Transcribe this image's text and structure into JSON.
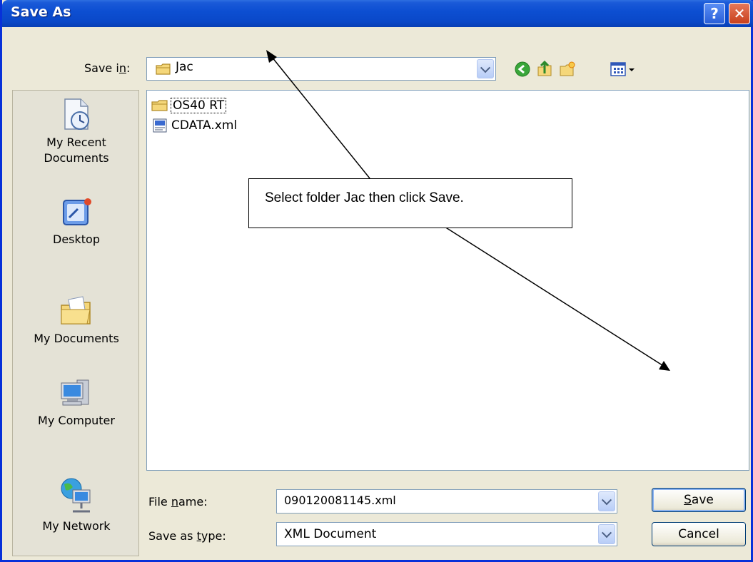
{
  "window": {
    "title": "Save As"
  },
  "title_buttons": {
    "help": "?",
    "close": "✕"
  },
  "save_in": {
    "label_pre": "Save i",
    "label_u": "n",
    "label_post": ":",
    "value": "Jac"
  },
  "toolbar": {
    "icons": [
      "back-icon",
      "up-folder-icon",
      "new-folder-icon",
      "views-menu-icon"
    ]
  },
  "places": [
    {
      "label": "My Recent Documents",
      "icon": "recent-documents-icon"
    },
    {
      "label": "Desktop",
      "icon": "desktop-icon"
    },
    {
      "label": "My Documents",
      "icon": "my-documents-icon"
    },
    {
      "label": "My Computer",
      "icon": "my-computer-icon"
    },
    {
      "label": "My Network",
      "icon": "my-network-icon"
    }
  ],
  "files": [
    {
      "name": "OS40 RT",
      "type": "folder"
    },
    {
      "name": "CDATA.xml",
      "type": "xml"
    }
  ],
  "annotation": {
    "text": "Select folder Jac then click Save."
  },
  "file_name": {
    "label_pre": "File ",
    "label_u": "n",
    "label_post": "ame:",
    "value": "090120081145.xml"
  },
  "save_as_type": {
    "label_pre": "Save as ",
    "label_u": "t",
    "label_post": "ype:",
    "value": "XML Document"
  },
  "buttons": {
    "save_u": "S",
    "save_rest": "ave",
    "cancel": "Cancel"
  },
  "colors": {
    "title_bar": "#0a48c8",
    "dialog_bg": "#ece9d8",
    "close_button": "#c8401c"
  }
}
